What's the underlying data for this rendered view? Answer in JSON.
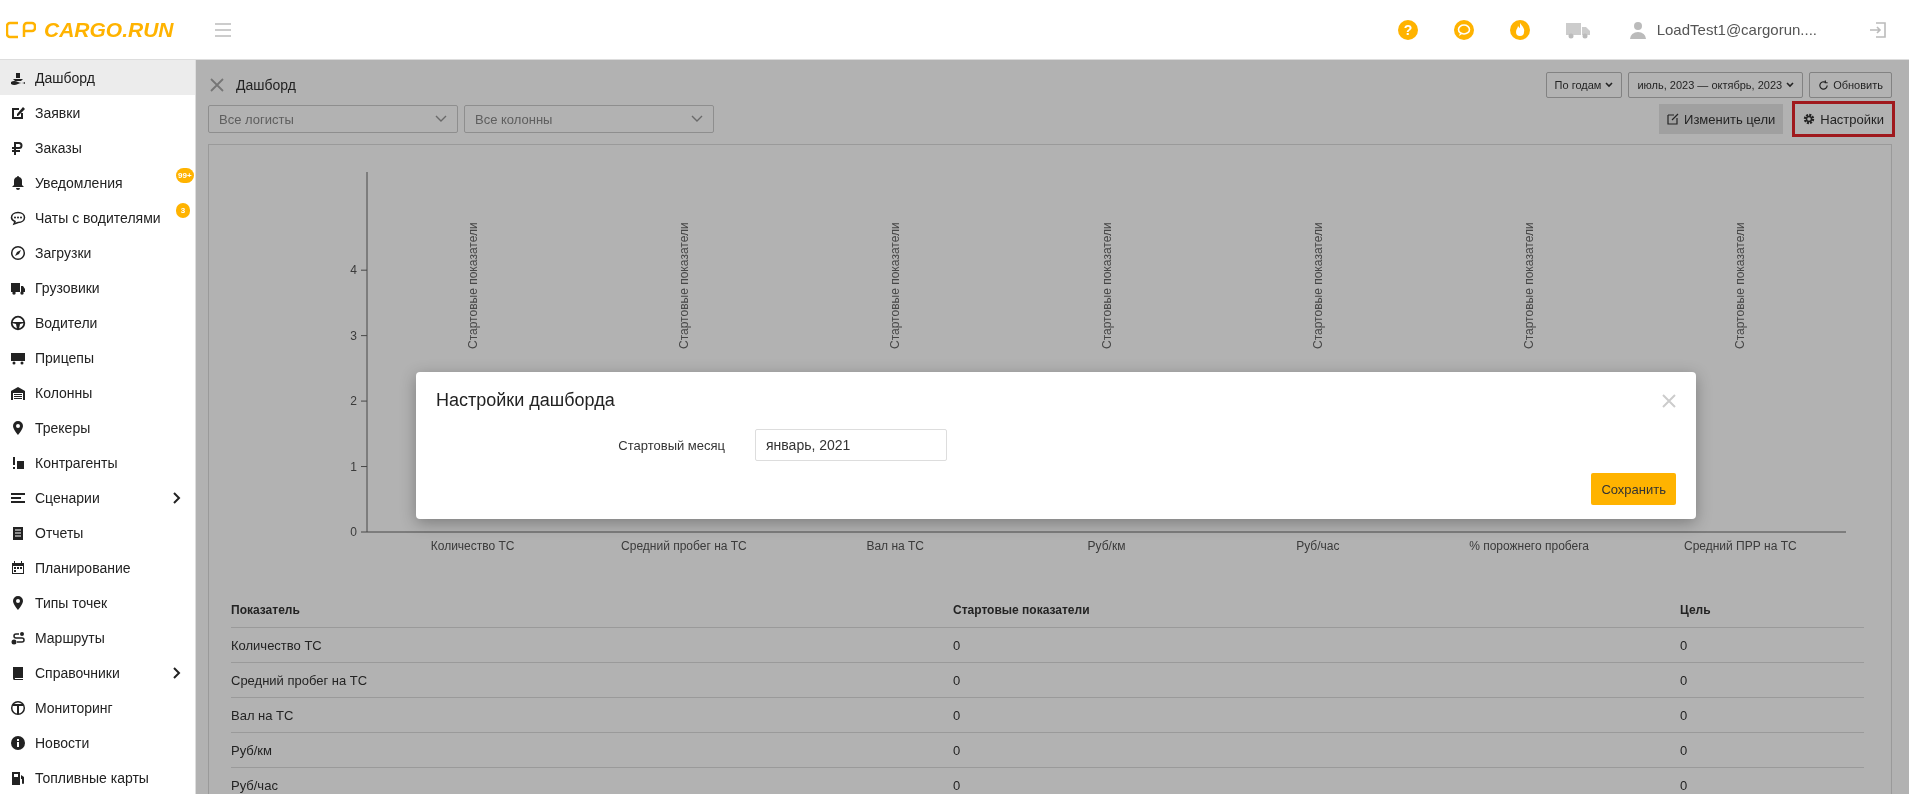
{
  "topbar": {
    "logo": "CARGO.RUN",
    "help": "?",
    "user": "LoadTest1@cargorun...."
  },
  "sidebar": {
    "items": [
      {
        "label": "Дашборд",
        "selected": true,
        "expandable": false
      },
      {
        "label": "Заявки",
        "selected": false,
        "expandable": false
      },
      {
        "label": "Заказы",
        "selected": false,
        "expandable": false
      },
      {
        "label": "Уведомления",
        "selected": false,
        "expandable": false,
        "badge": "99+"
      },
      {
        "label": "Чаты с водителями",
        "selected": false,
        "expandable": false,
        "badge": "3"
      },
      {
        "label": "Загрузки",
        "selected": false,
        "expandable": false
      },
      {
        "label": "Грузовики",
        "selected": false,
        "expandable": false
      },
      {
        "label": "Водители",
        "selected": false,
        "expandable": false
      },
      {
        "label": "Прицепы",
        "selected": false,
        "expandable": false
      },
      {
        "label": "Колонны",
        "selected": false,
        "expandable": false
      },
      {
        "label": "Трекеры",
        "selected": false,
        "expandable": false
      },
      {
        "label": "Контрагенты",
        "selected": false,
        "expandable": false
      },
      {
        "label": "Сценарии",
        "selected": false,
        "expandable": true
      },
      {
        "label": "Отчеты",
        "selected": false,
        "expandable": false
      },
      {
        "label": "Планирование",
        "selected": false,
        "expandable": false
      },
      {
        "label": "Типы точек",
        "selected": false,
        "expandable": false
      },
      {
        "label": "Маршруты",
        "selected": false,
        "expandable": false
      },
      {
        "label": "Справочники",
        "selected": false,
        "expandable": true
      },
      {
        "label": "Мониторинг",
        "selected": false,
        "expandable": false
      },
      {
        "label": "Новости",
        "selected": false,
        "expandable": false
      },
      {
        "label": "Топливные карты",
        "selected": false,
        "expandable": false
      }
    ]
  },
  "page": {
    "title": "Дашборд",
    "period_mode": "По годам",
    "date_range": "июль, 2023 — октябрь, 2023",
    "refresh": "Обновить",
    "filters": [
      {
        "placeholder": "Все логисты"
      },
      {
        "placeholder": "Все колонны"
      }
    ],
    "actions": [
      {
        "label": "Изменить цели",
        "highlighted": false
      },
      {
        "label": "Настройки",
        "highlighted": true
      }
    ],
    "chart_data": {
      "type": "bar",
      "categories": [
        "Количество ТС",
        "Средний пробег на ТС",
        "Вал на ТС",
        "Руб/км",
        "Руб/час",
        "% порожнего пробега",
        "Средний ПРР на ТС"
      ],
      "values": [
        0,
        0,
        0,
        0,
        0,
        0,
        0
      ],
      "ylim": [
        0,
        5.5
      ],
      "yticks": [
        0,
        1,
        2,
        3,
        4
      ]
    },
    "bar_captions": [
      "Стартовые показатели",
      "Стартовые показатели",
      "Стартовые показатели",
      "Стартовые показатели",
      "Стартовые показатели",
      "Стартовые показатели",
      "Стартовые показатели"
    ],
    "table": {
      "columns": [
        "Показатель",
        "Стартовые показатели",
        "Цель"
      ],
      "rows": [
        [
          "Количество ТС",
          "0",
          "0"
        ],
        [
          "Средний пробег на ТС",
          "0",
          "0"
        ],
        [
          "Вал на ТС",
          "0",
          "0"
        ],
        [
          "Руб/км",
          "0",
          "0"
        ],
        [
          "Руб/час",
          "0",
          "0"
        ]
      ]
    }
  },
  "modal": {
    "title": "Настройки дашборда",
    "field_label": "Стартовый месяц",
    "field_value": "январь, 2021",
    "save": "Сохранить"
  }
}
